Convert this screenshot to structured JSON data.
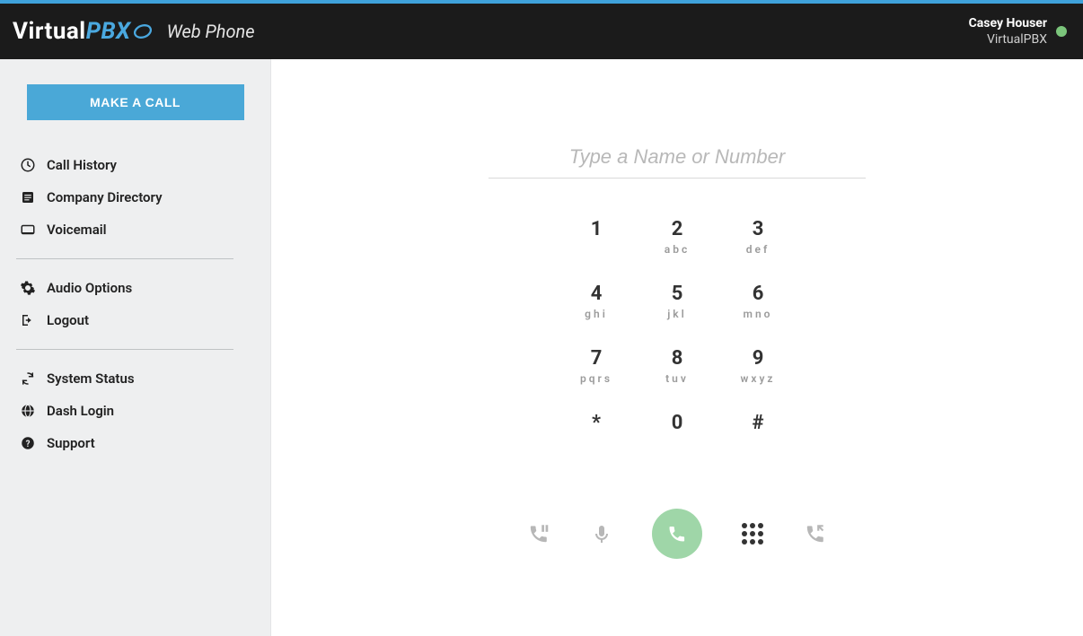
{
  "colors": {
    "accent": "#4aa8d7",
    "presence": "#7bc57b",
    "call_button": "#9fd6a8"
  },
  "header": {
    "logo_part1": "Virtual",
    "logo_part2": "PBX",
    "subtitle": "Web Phone",
    "user_name": "Casey Houser",
    "user_company": "VirtualPBX"
  },
  "sidebar": {
    "make_call_label": "MAKE A CALL",
    "group1": [
      {
        "icon": "clock-icon",
        "label": "Call History"
      },
      {
        "icon": "list-icon",
        "label": "Company Directory"
      },
      {
        "icon": "voicemail-icon",
        "label": "Voicemail"
      }
    ],
    "group2": [
      {
        "icon": "gear-icon",
        "label": "Audio Options"
      },
      {
        "icon": "logout-icon",
        "label": "Logout"
      }
    ],
    "group3": [
      {
        "icon": "refresh-icon",
        "label": "System Status"
      },
      {
        "icon": "globe-icon",
        "label": "Dash Login"
      },
      {
        "icon": "help-icon",
        "label": "Support"
      }
    ]
  },
  "dialer": {
    "input_placeholder": "Type a Name or Number",
    "input_value": "",
    "keys": [
      {
        "digit": "1",
        "letters": ""
      },
      {
        "digit": "2",
        "letters": "abc"
      },
      {
        "digit": "3",
        "letters": "def"
      },
      {
        "digit": "4",
        "letters": "ghi"
      },
      {
        "digit": "5",
        "letters": "jkl"
      },
      {
        "digit": "6",
        "letters": "mno"
      },
      {
        "digit": "7",
        "letters": "pqrs"
      },
      {
        "digit": "8",
        "letters": "tuv"
      },
      {
        "digit": "9",
        "letters": "wxyz"
      },
      {
        "digit": "*",
        "letters": ""
      },
      {
        "digit": "0",
        "letters": ""
      },
      {
        "digit": "#",
        "letters": ""
      }
    ],
    "controls": {
      "hold": "hold-icon",
      "mute": "mic-icon",
      "call": "phone-icon",
      "keypad": "dialpad-icon",
      "transfer": "transfer-icon"
    }
  }
}
